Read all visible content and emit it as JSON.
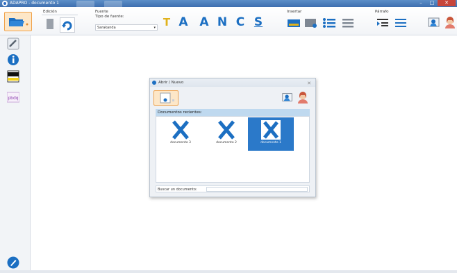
{
  "window": {
    "title": "ADAPRO - documento 1",
    "min_glyph": "–",
    "max_glyph": "□",
    "close_glyph": "✕"
  },
  "ribbon": {
    "groups": {
      "edicion": "Edición",
      "fuente": "Fuente",
      "insertar": "Insertar",
      "parrafo": "Párrafo"
    },
    "font_type_label": "Tipo de fuente:",
    "font_value": "Sarakanda",
    "format_buttons": [
      "T",
      "A",
      "A",
      "N",
      "C",
      "S"
    ]
  },
  "dialog": {
    "title": "Abrir / Nuevo",
    "close_glyph": "✕",
    "recent_header": "Documentos recientes:",
    "documents": [
      {
        "name": "documento 3",
        "selected": false
      },
      {
        "name": "documento 2",
        "selected": false
      },
      {
        "name": "documento 1",
        "selected": true
      }
    ],
    "search_label": "Buscar un documento:",
    "search_value": ""
  },
  "colors": {
    "accent": "#1c6fc2",
    "selected": "#2b79c9",
    "highlight_border": "#f0a24a",
    "highlight_fill": "#fde7c8"
  }
}
